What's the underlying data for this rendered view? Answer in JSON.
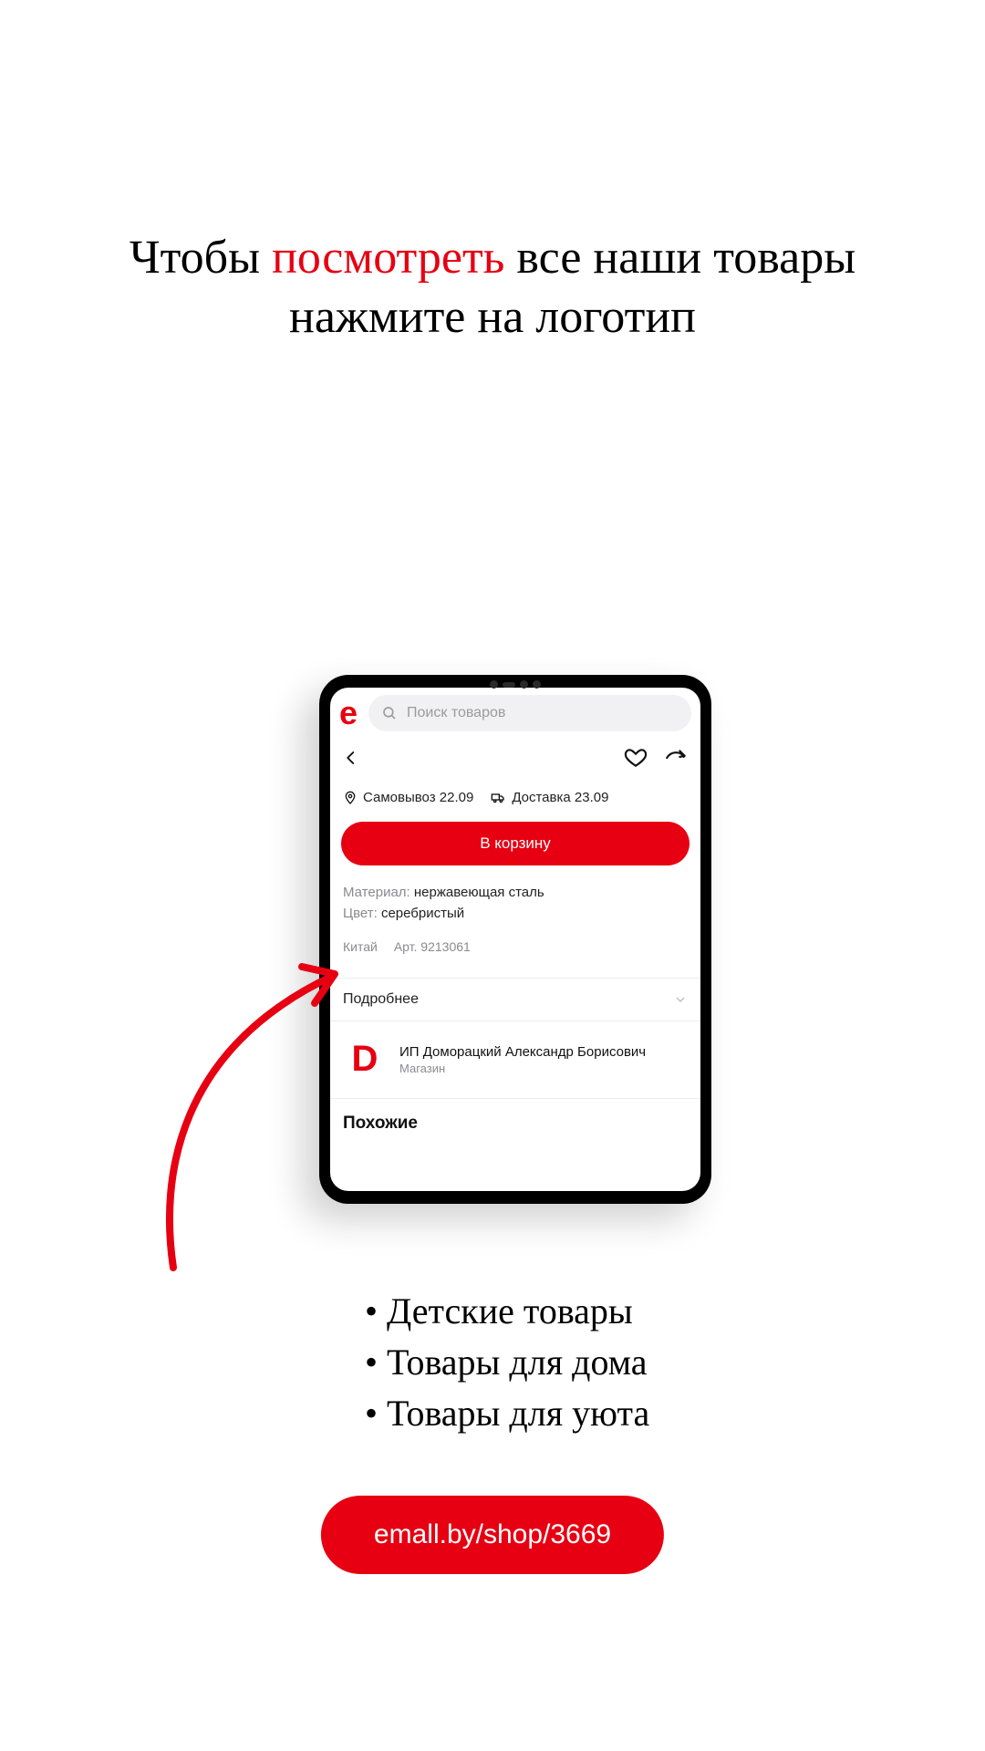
{
  "headline": {
    "part1": "Чтобы ",
    "accent": "посмотреть",
    "part2": " все наши товары",
    "line2": "нажмите на логотип"
  },
  "app": {
    "logo": "e",
    "search_placeholder": "Поиск товаров",
    "pickup_label": "Самовывоз 22.09",
    "delivery_label": "Доставка 23.09",
    "cart_button": "В корзину",
    "specs": {
      "material_label": "Материал:",
      "material_value": "нержавеющая сталь",
      "color_label": "Цвет:",
      "color_value": "серебристый"
    },
    "country": "Китай",
    "article": "Арт. 9213061",
    "more": "Подробнее",
    "seller": {
      "logo": "D",
      "name": "ИП Доморацкий Александр Борисович",
      "sub": "Магазин"
    },
    "similar": "Похожие"
  },
  "bullets": [
    "Детские товары",
    "Товары для дома",
    "Товары для уюта"
  ],
  "url": "emall.by/shop/3669"
}
